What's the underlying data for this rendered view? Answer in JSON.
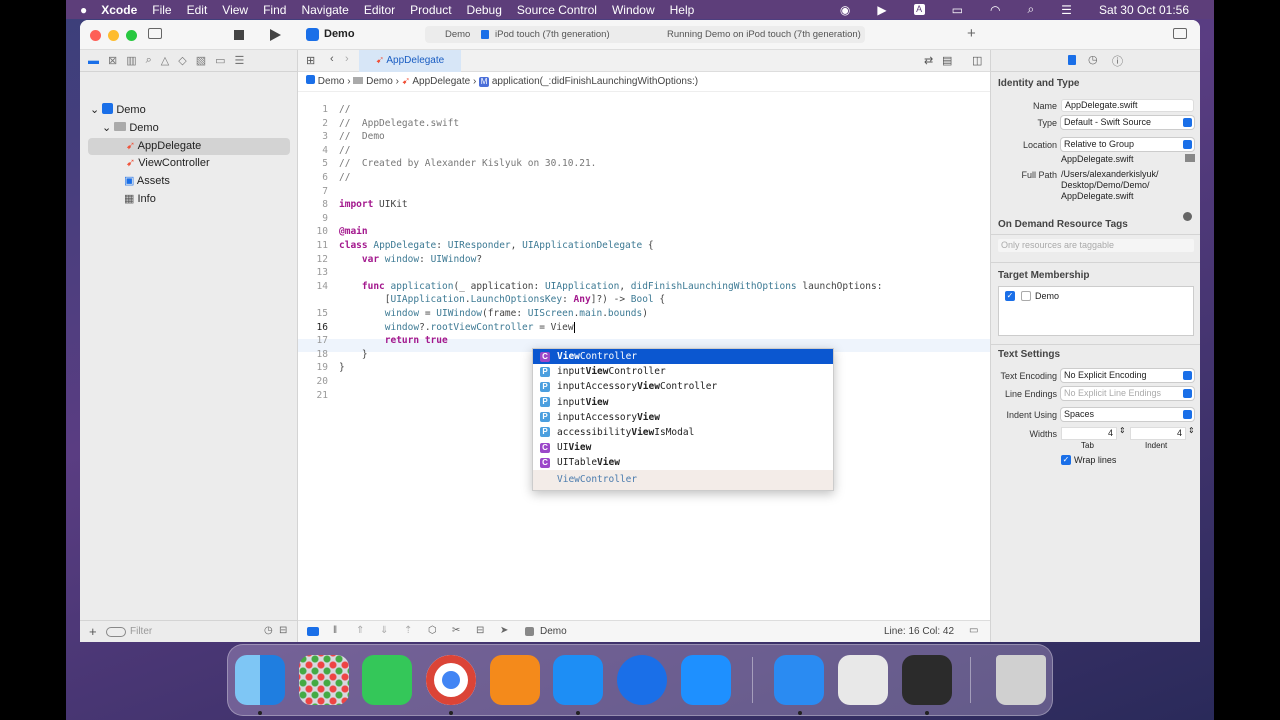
{
  "menubar": {
    "app": "Xcode",
    "items": [
      "File",
      "Edit",
      "View",
      "Find",
      "Navigate",
      "Editor",
      "Product",
      "Debug",
      "Source Control",
      "Window",
      "Help"
    ],
    "clock": "Sat 30 Oct  01:56"
  },
  "toolbar": {
    "scheme": "Demo",
    "target_app": "Demo",
    "device": "iPod touch (7th generation)",
    "status": "Running Demo on iPod touch (7th generation)"
  },
  "navigator": {
    "items": [
      {
        "label": "Demo",
        "icon": "project-icon"
      },
      {
        "label": "Demo",
        "icon": "folder-icon"
      },
      {
        "label": "AppDelegate",
        "icon": "swift-file-icon"
      },
      {
        "label": "ViewController",
        "icon": "swift-file-icon"
      },
      {
        "label": "Assets",
        "icon": "assets-icon"
      },
      {
        "label": "Info",
        "icon": "plist-icon"
      }
    ],
    "filter_placeholder": "Filter"
  },
  "editor": {
    "tab": "AppDelegate",
    "breadcrumb": [
      "Demo",
      "Demo",
      "AppDelegate",
      "application(_:didFinishLaunchingWithOptions:)"
    ],
    "line_numbers": [
      "1",
      "2",
      "3",
      "4",
      "5",
      "6",
      "7",
      "8",
      "9",
      "10",
      "11",
      "12",
      "13",
      "14",
      "",
      "15",
      "16",
      "17",
      "18",
      "19",
      "20",
      "21"
    ]
  },
  "autocomplete": {
    "items": [
      {
        "kind": "C",
        "pre": "",
        "match": "View",
        "post": "Controller"
      },
      {
        "kind": "P",
        "pre": "input",
        "match": "View",
        "post": "Controller"
      },
      {
        "kind": "P",
        "pre": "inputAccessory",
        "match": "View",
        "post": "Controller"
      },
      {
        "kind": "P",
        "pre": "input",
        "match": "View",
        "post": ""
      },
      {
        "kind": "P",
        "pre": "inputAccessory",
        "match": "View",
        "post": ""
      },
      {
        "kind": "P",
        "pre": "accessibility",
        "match": "View",
        "post": "IsModal"
      },
      {
        "kind": "C",
        "pre": "UI",
        "match": "View",
        "post": ""
      },
      {
        "kind": "C",
        "pre": "UITable",
        "match": "View",
        "post": ""
      }
    ],
    "footer": "ViewController"
  },
  "statusbar": {
    "target": "Demo",
    "position": "Line: 16  Col: 42"
  },
  "inspector": {
    "identity_title": "Identity and Type",
    "name_label": "Name",
    "name": "AppDelegate.swift",
    "type_label": "Type",
    "type": "Default - Swift Source",
    "location_label": "Location",
    "location": "Relative to Group",
    "location_file": "AppDelegate.swift",
    "fullpath_label": "Full Path",
    "fullpath": "/Users/alexanderkislyuk/\nDesktop/Demo/Demo/\nAppDelegate.swift",
    "odr_title": "On Demand Resource Tags",
    "odr_placeholder": "Only resources are taggable",
    "target_title": "Target Membership",
    "target_item": "Demo",
    "text_title": "Text Settings",
    "encoding_label": "Text Encoding",
    "encoding": "No Explicit Encoding",
    "endings_label": "Line Endings",
    "endings": "No Explicit Line Endings",
    "indent_label": "Indent Using",
    "indent": "Spaces",
    "widths_label": "Widths",
    "tab_width": "4",
    "indent_width": "4",
    "tab_label": "Tab",
    "indent_sub_label": "Indent",
    "wrap_label": "Wrap lines"
  },
  "dock": [
    "finder",
    "launchpad",
    "facetime",
    "chrome",
    "books",
    "xcode",
    "maps",
    "app-store",
    "instruments",
    "system-info",
    "quicktime",
    "trash"
  ],
  "colors": {
    "accent": "#1a6fe8",
    "keyword": "#a3188d",
    "selection": "#0b57d0"
  }
}
